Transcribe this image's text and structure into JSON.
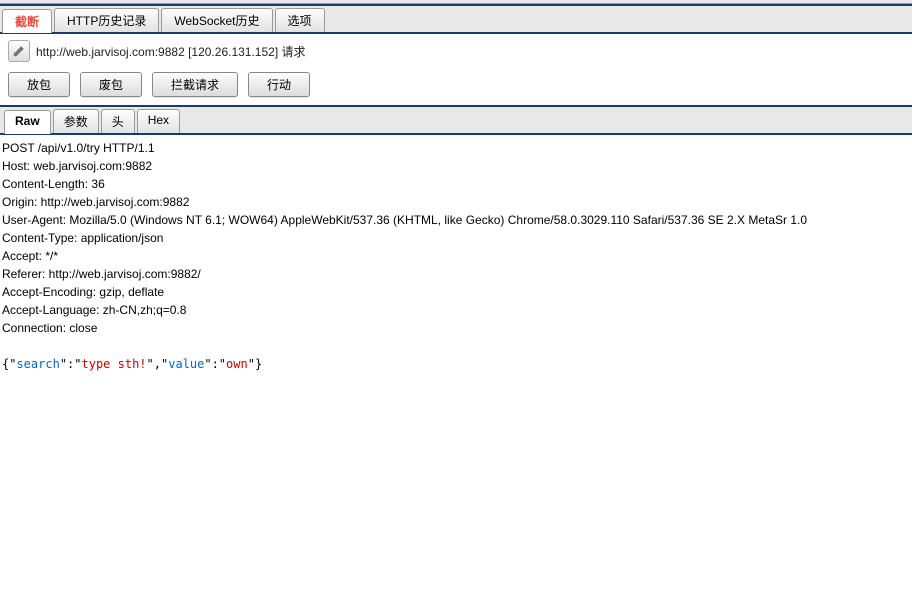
{
  "subTabs": {
    "intercept": "截断",
    "httpHistory": "HTTP历史记录",
    "wsHistory": "WebSocket历史",
    "options": "选项"
  },
  "address": "http://web.jarvisoj.com:9882  [120.26.131.152] 请求",
  "buttons": {
    "forward": "放包",
    "drop": "废包",
    "intercept": "拦截请求",
    "action": "行动"
  },
  "viewTabs": {
    "raw": "Raw",
    "params": "参数",
    "headers": "头",
    "hex": "Hex"
  },
  "raw": [
    "POST /api/v1.0/try HTTP/1.1",
    "Host: web.jarvisoj.com:9882",
    "Content-Length: 36",
    "Origin: http://web.jarvisoj.com:9882",
    "User-Agent: Mozilla/5.0 (Windows NT 6.1; WOW64) AppleWebKit/537.36 (KHTML, like Gecko) Chrome/58.0.3029.110 Safari/537.36 SE 2.X MetaSr 1.0",
    "Content-Type: application/json",
    "Accept: */*",
    "Referer: http://web.jarvisoj.com:9882/",
    "Accept-Encoding: gzip, deflate",
    "Accept-Language: zh-CN,zh;q=0.8",
    "Connection: close"
  ],
  "jsonBody": {
    "k1": "search",
    "v1": "type sth!",
    "k2": "value",
    "v2": "own"
  }
}
